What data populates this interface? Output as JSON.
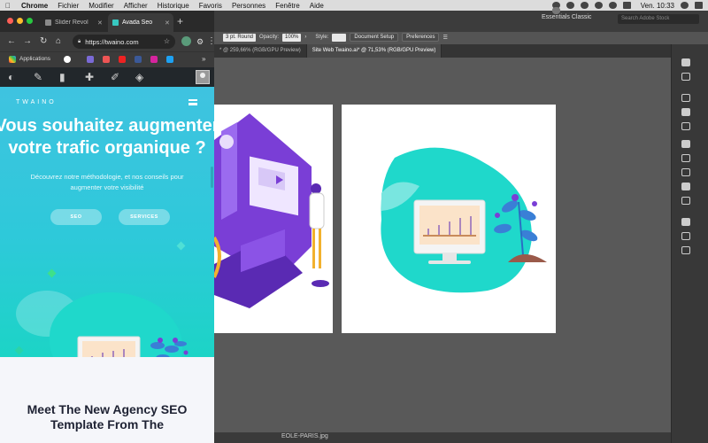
{
  "menubar": {
    "apple": "",
    "items": [
      "Chrome",
      "Fichier",
      "Modifier",
      "Afficher",
      "Historique",
      "Favoris",
      "Personnes",
      "Fenêtre",
      "Aide"
    ],
    "clock": "Ven. 10:33"
  },
  "illustrator": {
    "workspace": "Essentials Classic",
    "search_placeholder": "Search Adobe Stock",
    "stroke_value": "3 pt. Round",
    "opacity_label": "Opacity:",
    "opacity_value": "100%",
    "style_label": "Style:",
    "document_setup_label": "Document Setup",
    "preferences_label": "Preferences",
    "tabs": [
      "* @ 259,66% (RGB/GPU Preview)",
      "Site Web Twaino.ai* @ 71,53% (RGB/GPU Preview)"
    ],
    "bottom_filename": "EOLE-PARIS.jpg"
  },
  "browser": {
    "tabs": [
      {
        "label": "Slider Revol",
        "favicon_color": "#8a8a8a"
      },
      {
        "label": "Avada Seo",
        "favicon_color": "#37c8c0"
      }
    ],
    "new_tab": "+",
    "url": "https://twaino.com",
    "bookmarks_label": "Applications",
    "wp_icons": [
      "dashboard-icon",
      "brush-icon",
      "comment-icon",
      "plus-icon",
      "pen-icon",
      "avada-icon"
    ]
  },
  "site": {
    "logo": "TWAINO",
    "headline_line1": "Vous souhaitez augmenter",
    "headline_line2": "votre trafic organique ?",
    "subtitle": "Découvrez notre méthodologie, et nos conseils pour augmenter votre visibilité",
    "button_seo": "SEO",
    "button_services": "SERVICES",
    "section_title": "Meet The New Agency SEO Template From The"
  },
  "colors": {
    "hero_teal": "#2ec9da",
    "section_bg": "#f5f6fa",
    "illustration_teal": "#1fd8cb",
    "purple": "#6a2bc6"
  }
}
